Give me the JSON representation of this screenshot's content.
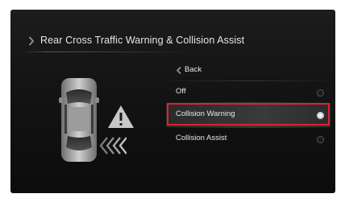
{
  "header": {
    "title": "Rear Cross Traffic Warning & Collision Assist"
  },
  "menu": {
    "back_label": "Back",
    "items": [
      {
        "label": "Off",
        "selected": false
      },
      {
        "label": "Collision Warning",
        "selected": true
      },
      {
        "label": "Collision Assist",
        "selected": false
      }
    ]
  },
  "icons": {
    "title": "chevron-right-icon",
    "back": "chevron-left-icon",
    "car": "car-top-view-icon",
    "warning": "warning-triangle-icon",
    "arrows": "rear-traffic-arrows-icon"
  },
  "colors": {
    "highlight": "#d8242e",
    "text": "#e8e8e8",
    "background": "#141414"
  }
}
